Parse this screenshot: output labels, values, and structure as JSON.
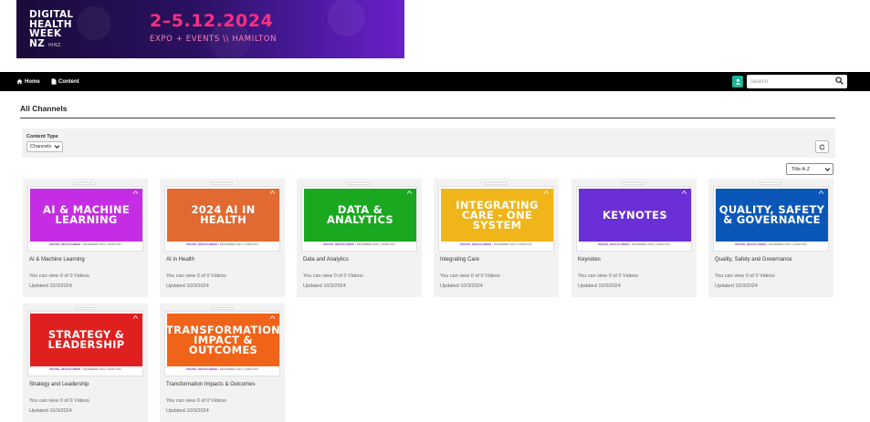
{
  "banner": {
    "logo_lines": [
      "DIGITAL",
      "HEALTH",
      "WEEK",
      "NZ"
    ],
    "logo_sub": "HINZ",
    "dates": "2–5.12.2024",
    "event_line": "EXPO + EVENTS \\\\ HAMILTON",
    "colors": {
      "background": "#2a1160",
      "dates": "#ff2f7f"
    }
  },
  "nav": {
    "home_label": "Home",
    "content_label": "Content",
    "home_icon": "home-icon",
    "content_icon": "document-icon"
  },
  "search": {
    "placeholder": "Search",
    "icon": "search-icon"
  },
  "user_icon": "user-icon",
  "page": {
    "title": "All Channels"
  },
  "filter": {
    "content_type_label": "Content Type",
    "content_type_value": "Channels",
    "sort_value": "Title A-Z",
    "refresh_icon": "refresh-icon"
  },
  "thumb_footer": {
    "brand": "DIGITAL HEALTH WEEK",
    "rest": " | DECEMBER 2024 | HAMILTON"
  },
  "channels": [
    {
      "thumb_title": "AI & MACHINE LEARNING",
      "name": "AI & Machine Learning",
      "views": "You can view 0 of 0 Videos",
      "updated": "Updated 10/3/2024",
      "color": "#c42de3"
    },
    {
      "thumb_title": "2024 AI IN HEALTH",
      "name": "AI in Health",
      "views": "You can view 0 of 0 Videos",
      "updated": "Updated 10/3/2024",
      "color": "#e06a32"
    },
    {
      "thumb_title": "DATA & ANALYTICS",
      "name": "Data and Analytics",
      "views": "You can view 0 of 0 Videos",
      "updated": "Updated 10/3/2024",
      "color": "#1aa820"
    },
    {
      "thumb_title": "INTEGRATING CARE - ONE SYSTEM",
      "name": "Integrating Care",
      "views": "You can view 0 of 0 Videos",
      "updated": "Updated 10/3/2024",
      "color": "#f0b519"
    },
    {
      "thumb_title": "KEYNOTES",
      "name": "Keynotes",
      "views": "You can view 0 of 0 Videos",
      "updated": "Updated 10/3/2024",
      "color": "#6a2fd6"
    },
    {
      "thumb_title": "QUALITY, SAFETY & GOVERNANCE",
      "name": "Quality, Safety and Governance",
      "views": "You can view 0 of 0 Videos",
      "updated": "Updated 10/3/2024",
      "color": "#0a57b8"
    },
    {
      "thumb_title": "STRATEGY & LEADERSHIP",
      "name": "Strategy and Leadership",
      "views": "You can view 0 of 0 Videos",
      "updated": "Updated 10/3/2024",
      "color": "#e01f1f"
    },
    {
      "thumb_title": "TRANSFORMATION IMPACT & OUTCOMES",
      "name": "Transformation Impacts & Outcomes",
      "views": "You can view 0 of 0 Videos",
      "updated": "Updated 10/3/2024",
      "color": "#f0641a"
    }
  ]
}
